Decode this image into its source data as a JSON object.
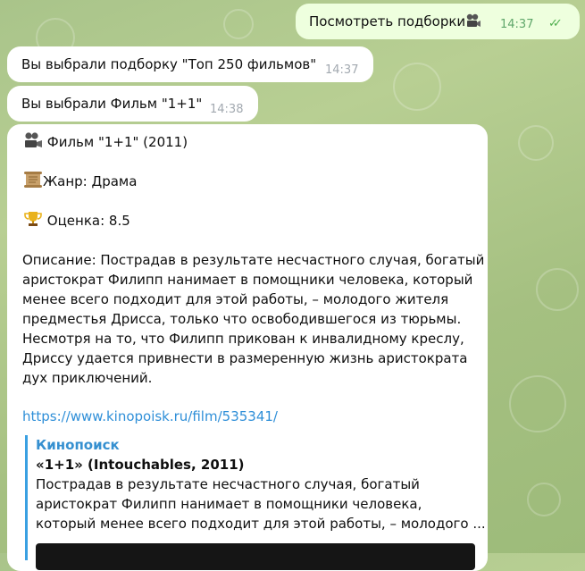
{
  "messages": {
    "outgoing": {
      "text": "Посмотреть подборки",
      "time": "14:37",
      "icon": "film-projector-icon"
    },
    "selection": {
      "text": "Вы выбрали подборку \"Топ 250 фильмов\"",
      "time": "14:37"
    },
    "film_choice": {
      "text": "Вы выбрали Фильм \"1+1\"",
      "time": "14:38"
    }
  },
  "card": {
    "title": "Фильм \"1+1\" (2011)",
    "title_icon": "film-projector-icon",
    "genre": "Жанр: Драма",
    "genre_icon": "scroll-icon",
    "rating": "Оценка: 8.5",
    "rating_icon": "trophy-icon",
    "description_lines": [
      "Описание: Пострадав в результате несчастного случая, богатый",
      "аристократ Филипп нанимает в помощники человека, который",
      "менее всего подходит для этой работы, – молодого жителя",
      "предместья Дрисса, только что освободившегося из тюрьмы.",
      "Несмотря на то, что Филипп прикован к инвалидному креслу,",
      "Дриссу удается привнести в размеренную жизнь аристократа",
      "дух приключений."
    ],
    "link": "https://www.kinopoisk.ru/film/535341/",
    "preview": {
      "site": "Кинопоиск",
      "title": "«1+1» (Intouchables, 2011)",
      "desc_lines": [
        "Пострадав в результате несчастного случая, богатый",
        "аристократ Филипп нанимает в помощники человека,",
        "который менее всего подходит для этой работы, – молодого ..."
      ]
    }
  }
}
